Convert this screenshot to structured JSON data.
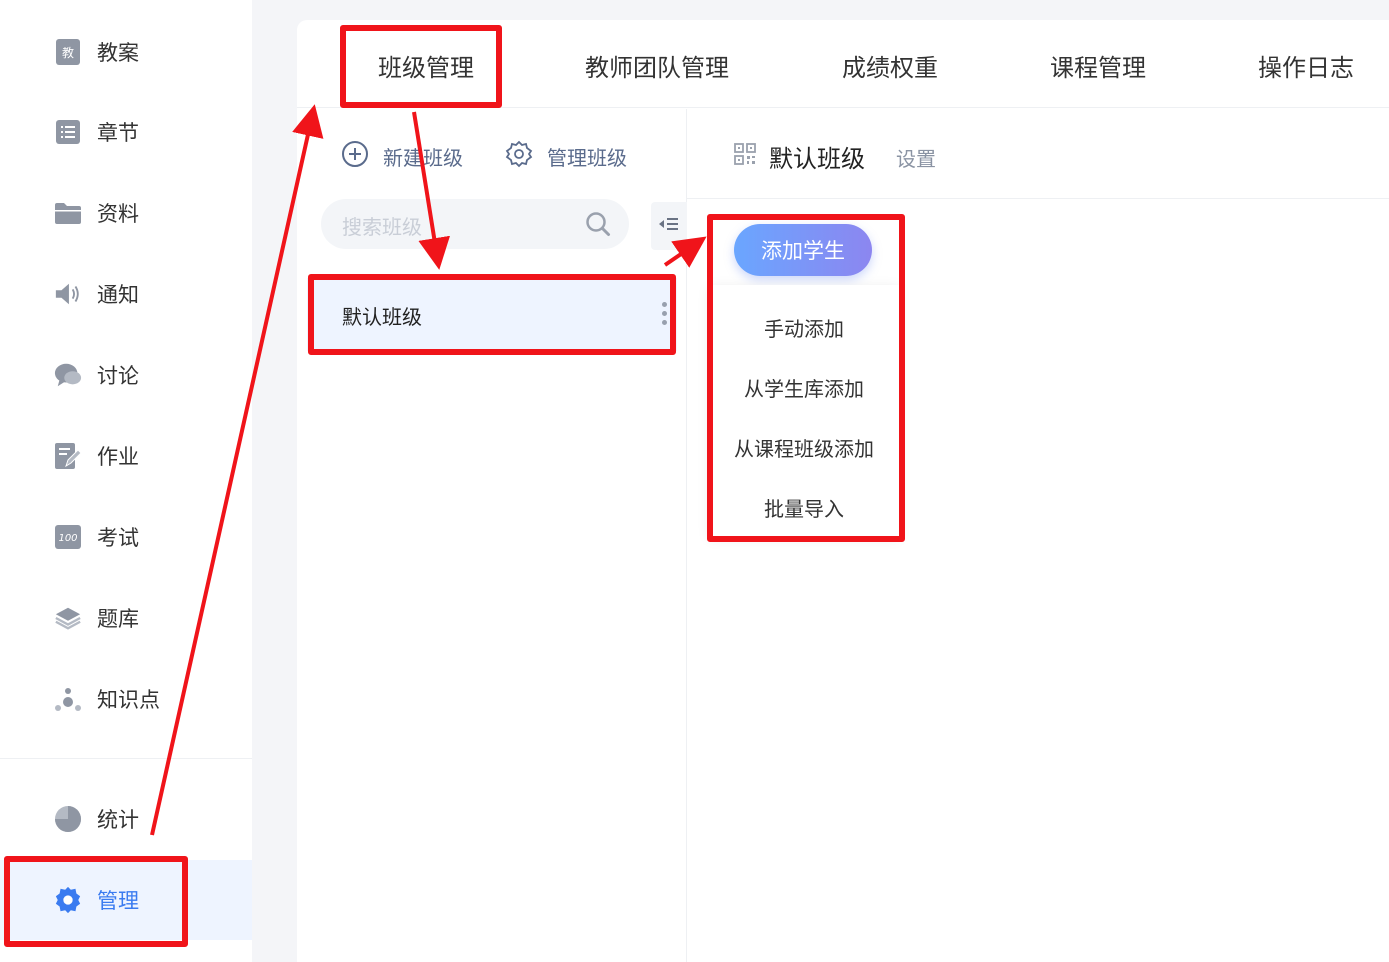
{
  "sidebar": {
    "items": [
      {
        "label": "教案",
        "icon": "lesson-plan-icon"
      },
      {
        "label": "章节",
        "icon": "list-icon"
      },
      {
        "label": "资料",
        "icon": "folder-icon"
      },
      {
        "label": "通知",
        "icon": "speaker-icon"
      },
      {
        "label": "讨论",
        "icon": "chat-bubble-icon"
      },
      {
        "label": "作业",
        "icon": "edit-document-icon"
      },
      {
        "label": "考试",
        "icon": "score-100-icon"
      },
      {
        "label": "题库",
        "icon": "layers-icon"
      },
      {
        "label": "知识点",
        "icon": "nodes-icon"
      }
    ],
    "bottom_items": [
      {
        "label": "统计",
        "icon": "pie-chart-icon"
      },
      {
        "label": "管理",
        "icon": "gear-icon",
        "active": true
      }
    ],
    "lesson_icon_char": "教"
  },
  "tabs": [
    "班级管理",
    "教师团队管理",
    "成绩权重",
    "课程管理",
    "操作日志"
  ],
  "toolbar": {
    "new_class_label": "新建班级",
    "manage_class_label": "管理班级"
  },
  "search": {
    "placeholder": "搜索班级"
  },
  "class_list": [
    {
      "name": "默认班级"
    }
  ],
  "class_header": {
    "title": "默认班级",
    "settings_label": "设置"
  },
  "add_student": {
    "button_label": "添加学生",
    "menu": [
      "手动添加",
      "从学生库添加",
      "从课程班级添加",
      "批量导入"
    ]
  },
  "colors": {
    "accent": "#3a7bf0",
    "annotation_red": "#f0141a",
    "active_bg": "#eef4ff"
  }
}
